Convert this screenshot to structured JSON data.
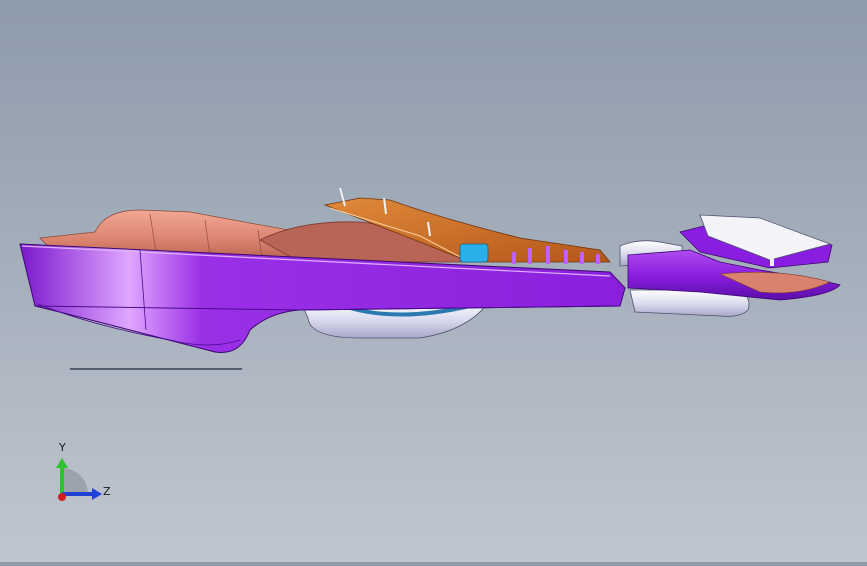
{
  "triad": {
    "y_label": "Y",
    "z_label": "Z",
    "y_color": "#2ec22e",
    "z_color": "#2040d8",
    "x_color": "#d02020"
  },
  "model": {
    "primary_color": "#8a1ee0",
    "secondary_color": "#d9826e",
    "accent_color": "#c8641e",
    "highlight_color": "#2ab0e8"
  }
}
